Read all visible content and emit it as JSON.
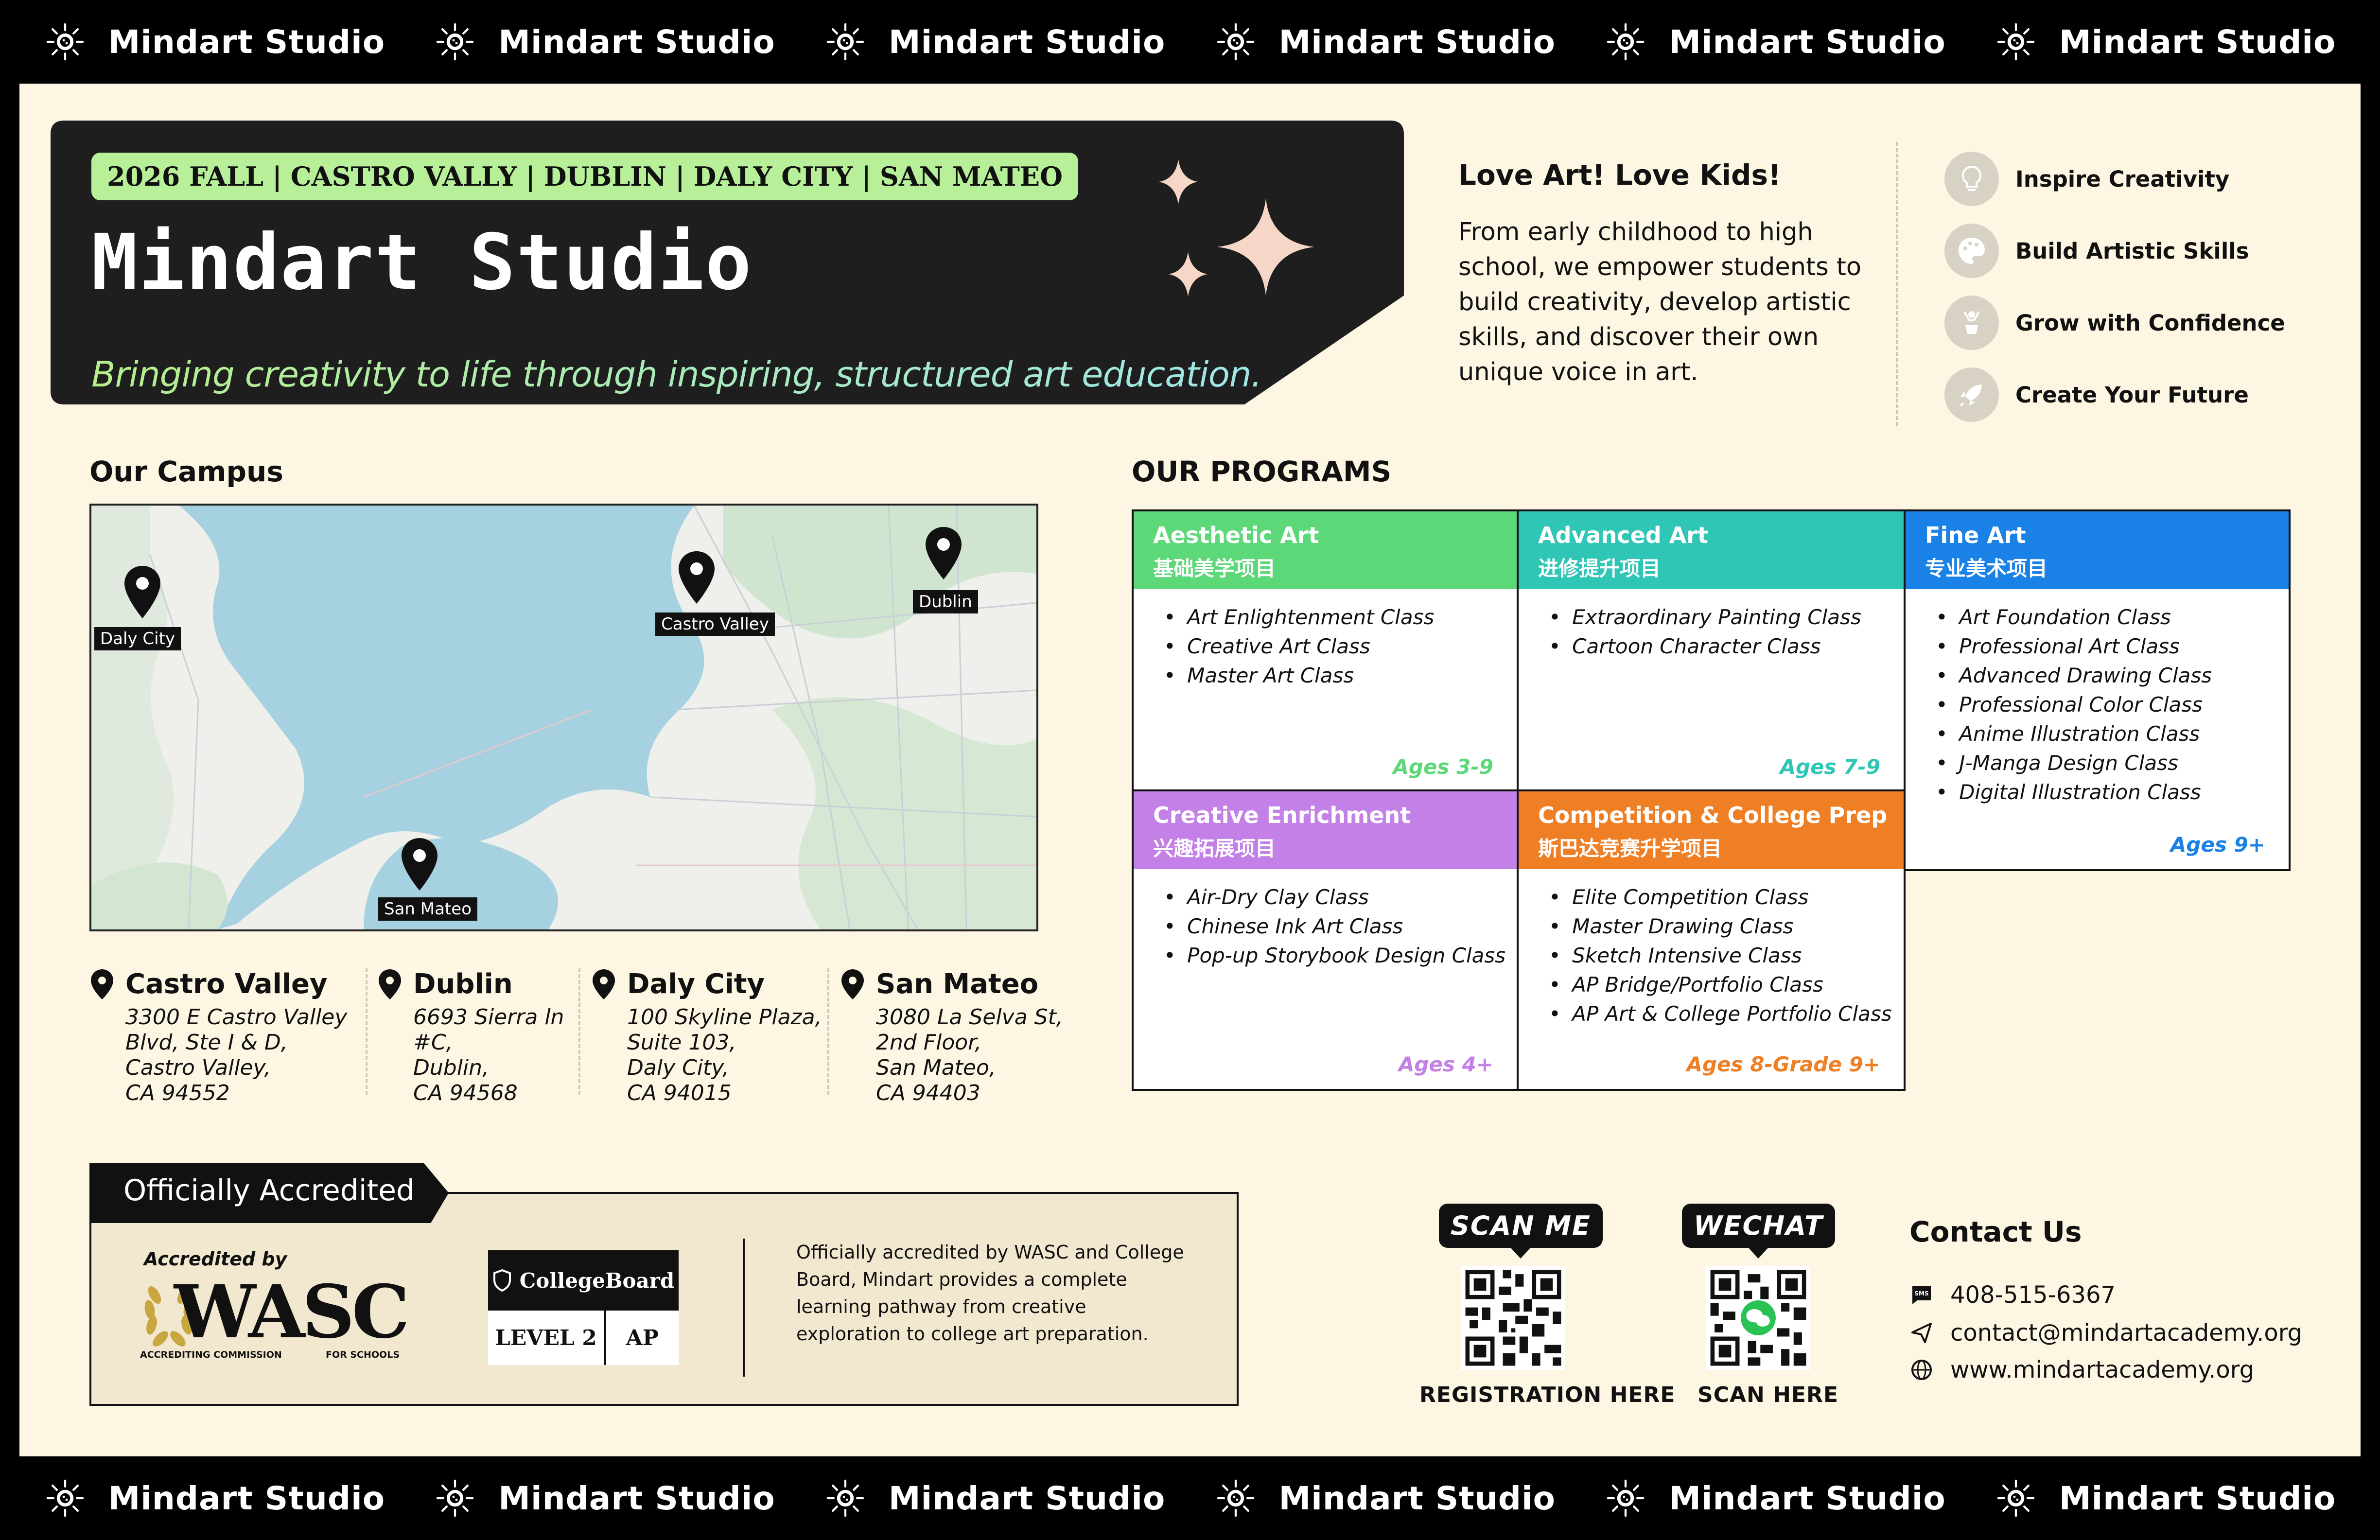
{
  "brand": {
    "name": "Mindart Studio"
  },
  "hero": {
    "tags": [
      "2026 FALL",
      "CASTRO VALLY",
      "DUBLIN",
      "DALY CITY",
      "SAN MATEO"
    ],
    "title": "Mindart Studio",
    "subtitle": "Bringing creativity to life through inspiring, structured art education."
  },
  "about": {
    "heading": "Love Art! Love Kids!",
    "text": "From early childhood to high school, we empower students to build creativity, develop artistic skills, and discover their own unique voice in art."
  },
  "values": [
    {
      "label": "Inspire Creativity",
      "icon": "lightbulb-icon"
    },
    {
      "label": "Build Artistic Skills",
      "icon": "palette-icon"
    },
    {
      "label": "Grow with Confidence",
      "icon": "trophy-icon"
    },
    {
      "label": "Create Your Future",
      "icon": "rocket-icon"
    }
  ],
  "campus": {
    "heading": "Our Campus",
    "map_pins": [
      "Daly City",
      "Castro Valley",
      "Dublin",
      "San Mateo"
    ],
    "locations": [
      {
        "name": "Castro Valley",
        "address": [
          "3300 E Castro Valley",
          "Blvd, Ste I & D,",
          "Castro Valley,",
          "CA 94552"
        ]
      },
      {
        "name": "Dublin",
        "address": [
          "6693 Sierra ln",
          "#C,",
          "Dublin,",
          "CA 94568"
        ]
      },
      {
        "name": "Daly City",
        "address": [
          "100 Skyline Plaza,",
          "Suite 103,",
          "Daly City,",
          "CA 94015"
        ]
      },
      {
        "name": "San Mateo",
        "address": [
          "3080 La Selva St,",
          "2nd Floor,",
          "San Mateo,",
          "CA 94403"
        ]
      }
    ]
  },
  "programs": {
    "heading": "OUR PROGRAMS",
    "items": [
      {
        "title": "Aesthetic Art",
        "chinese": "基础美学项目",
        "color": "#5dd879",
        "ages": "Ages 3-9",
        "classes": [
          "Art Enlightenment Class",
          "Creative Art Class",
          "Master Art Class"
        ]
      },
      {
        "title": "Advanced Art",
        "chinese": "进修提升项目",
        "color": "#2fc6b5",
        "ages": "Ages 7-9",
        "classes": [
          "Extraordinary Painting Class",
          "Cartoon Character Class"
        ]
      },
      {
        "title": "Fine Art",
        "chinese": "专业美术项目",
        "color": "#1a82e6",
        "ages": "Ages 9+",
        "classes": [
          "Art Foundation Class",
          "Professional Art Class",
          "Advanced Drawing Class",
          "Professional Color Class",
          "Anime Illustration Class",
          "J-Manga Design Class",
          "Digital Illustration Class"
        ]
      },
      {
        "title": "Creative Enrichment",
        "chinese": "兴趣拓展项目",
        "color": "#c380e6",
        "ages": "Ages 4+",
        "classes": [
          "Air-Dry Clay Class",
          "Chinese Ink Art Class",
          "Pop-up Storybook Design Class"
        ]
      },
      {
        "title": "Competition & College Prep",
        "chinese": "斯巴达竞赛升学项目",
        "color": "#ef7f25",
        "ages": "Ages 8-Grade 9+",
        "classes": [
          "Elite Competition Class",
          "Master Drawing Class",
          "Sketch Intensive Class",
          "AP Bridge/Portfolio Class",
          "AP Art & College Portfolio Class"
        ]
      }
    ]
  },
  "accreditation": {
    "tab": "Officially Accredited",
    "wasc_label": "Accredited by",
    "wasc_logo": "WASC",
    "wasc_caption_left": "ACCREDITING COMMISSION",
    "wasc_caption_right": "FOR SCHOOLS",
    "cb_name": "CollegeBoard",
    "cb_level": "LEVEL 2",
    "cb_ap": "AP",
    "text": "Officially accredited by WASC and College Board, Mindart provides a complete learning pathway from creative exploration to college art preparation."
  },
  "qr": [
    {
      "bubble": "SCAN ME",
      "caption": "REGISTRATION HERE"
    },
    {
      "bubble": "WECHAT",
      "caption": "SCAN HERE"
    }
  ],
  "contact": {
    "heading": "Contact Us",
    "phone": "408-515-6367",
    "email": "contact@mindartacademy.org",
    "website": "www.mindartacademy.org"
  }
}
